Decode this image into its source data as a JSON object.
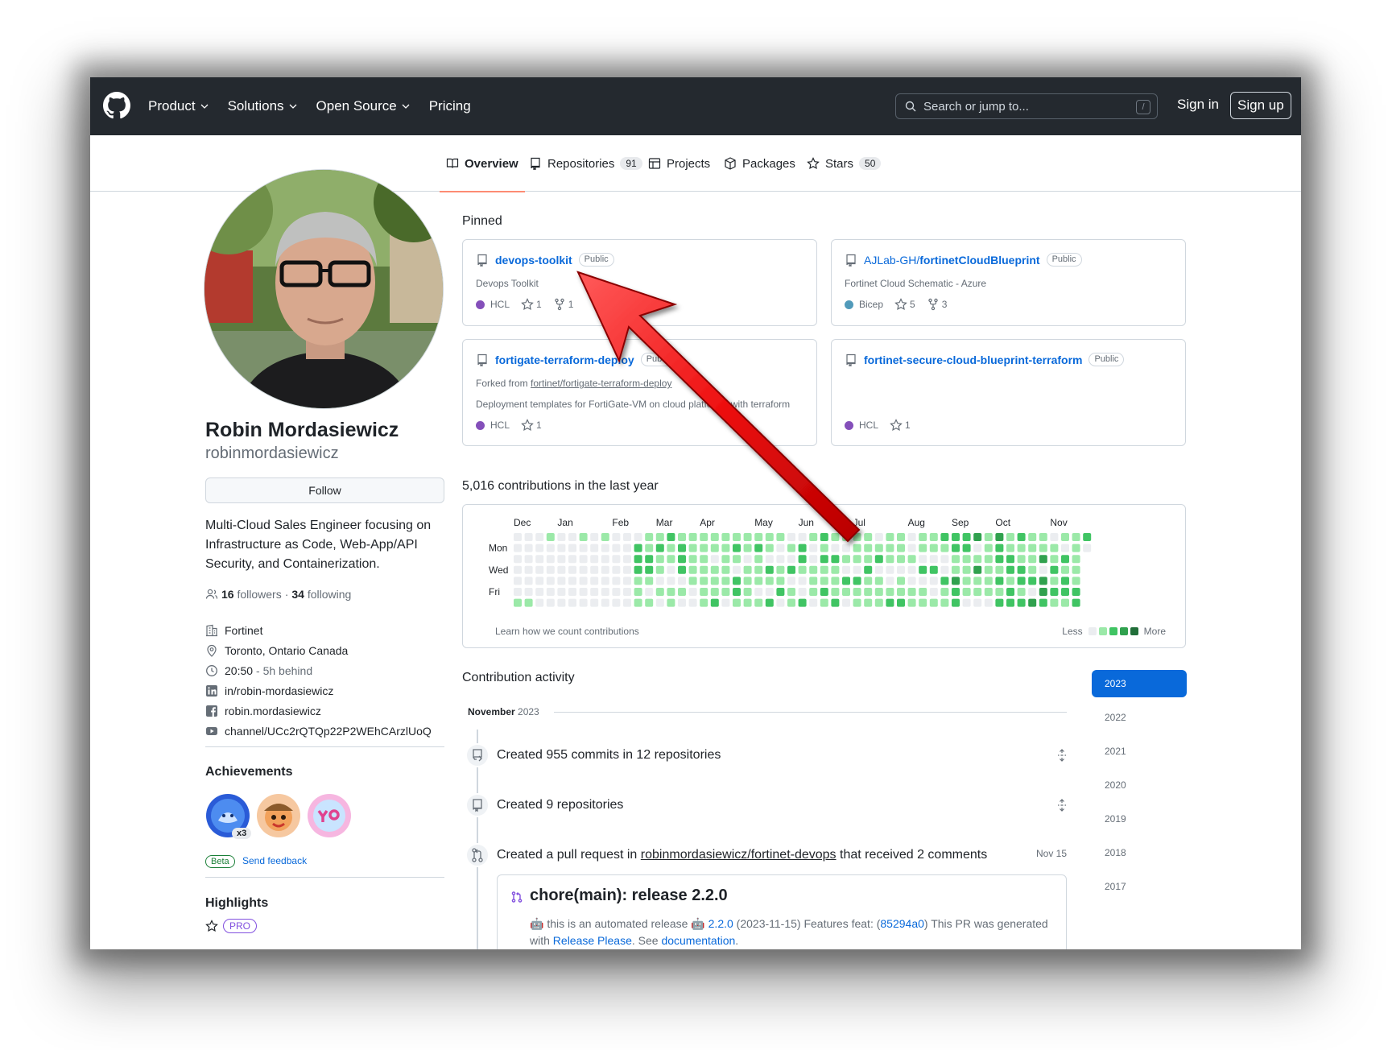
{
  "header": {
    "nav": [
      {
        "label": "Product",
        "dropdown": true
      },
      {
        "label": "Solutions",
        "dropdown": true
      },
      {
        "label": "Open Source",
        "dropdown": true
      },
      {
        "label": "Pricing",
        "dropdown": false
      }
    ],
    "search_placeholder": "Search or jump to...",
    "search_shortcut": "/",
    "sign_in": "Sign in",
    "sign_up": "Sign up"
  },
  "tabs": [
    {
      "label": "Overview",
      "count": "",
      "icon": "book-icon"
    },
    {
      "label": "Repositories",
      "count": "91",
      "icon": "repo-icon"
    },
    {
      "label": "Projects",
      "count": "",
      "icon": "table-icon"
    },
    {
      "label": "Packages",
      "count": "",
      "icon": "package-icon"
    },
    {
      "label": "Stars",
      "count": "50",
      "icon": "star-icon"
    }
  ],
  "profile": {
    "name": "Robin Mordasiewicz",
    "login": "robinmordasiewicz",
    "follow_label": "Follow",
    "bio": "Multi-Cloud Sales Engineer focusing on Infrastructure as Code, Web-App/API Security, and Containerization.",
    "followers": "16",
    "followers_label": "followers",
    "separator": "·",
    "following": "34",
    "following_label": "following",
    "details": [
      {
        "icon": "organization-icon",
        "text": "Fortinet"
      },
      {
        "icon": "location-icon",
        "text": "Toronto, Ontario Canada"
      },
      {
        "icon": "clock-icon",
        "text": "20:50",
        "muted": "- 5h behind"
      },
      {
        "icon": "linkedin-icon",
        "text": "in/robin-mordasiewicz"
      },
      {
        "icon": "facebook-icon",
        "text": "robin.mordasiewicz"
      },
      {
        "icon": "youtube-icon",
        "text": "channel/UCc2rQTQp22P2WEhCArzlUoQ"
      }
    ],
    "achievements_heading": "Achievements",
    "achievement_count": "x3",
    "beta_label": "Beta",
    "feedback_label": "Send feedback",
    "highlights_heading": "Highlights",
    "pro_label": "PRO"
  },
  "pinned": {
    "heading": "Pinned",
    "repos": [
      {
        "owner": "",
        "name": "devops-toolkit",
        "visibility": "Public",
        "forked_prefix": "",
        "forked_from": "",
        "description": "Devops Toolkit",
        "language": "HCL",
        "lang_color": "#844fba",
        "stars": "1",
        "forks": "1"
      },
      {
        "owner": "AJLab-GH/",
        "name": "fortinetCloudBlueprint",
        "visibility": "Public",
        "forked_prefix": "",
        "forked_from": "",
        "description": "Fortinet Cloud Schematic - Azure",
        "language": "Bicep",
        "lang_color": "#519aba",
        "stars": "5",
        "forks": "3"
      },
      {
        "owner": "",
        "name": "fortigate-terraform-deploy",
        "visibility": "Public",
        "forked_prefix": "Forked from",
        "forked_from": "fortinet/fortigate-terraform-deploy",
        "description": "Deployment templates for FortiGate-VM on cloud platforms with terraform",
        "language": "HCL",
        "lang_color": "#844fba",
        "stars": "1",
        "forks": ""
      },
      {
        "owner": "",
        "name": "fortinet-secure-cloud-blueprint-terraform",
        "visibility": "Public",
        "forked_prefix": "",
        "forked_from": "",
        "description": "",
        "language": "HCL",
        "lang_color": "#844fba",
        "stars": "1",
        "forks": ""
      }
    ]
  },
  "contributions": {
    "heading": "5,016 contributions in the last year",
    "months": [
      "Dec",
      "Jan",
      "Feb",
      "Mar",
      "Apr",
      "May",
      "Jun",
      "Jul",
      "Aug",
      "Sep",
      "Oct",
      "Nov"
    ],
    "day_labels": [
      "Mon",
      "Wed",
      "Fri"
    ],
    "learn_label": "Learn how we count contributions",
    "legend_less": "Less",
    "legend_more": "More",
    "level_colors": [
      "#ebedf0",
      "#9be9a8",
      "#40c463",
      "#30a14e",
      "#216e39"
    ]
  },
  "activity": {
    "heading": "Contribution activity",
    "month": "November",
    "year": "2023",
    "years": [
      "2023",
      "2022",
      "2021",
      "2020",
      "2019",
      "2018",
      "2017"
    ],
    "items": [
      {
        "text": "Created 955 commits in 12 repositories",
        "icon": "repo-push-icon"
      },
      {
        "text": "Created 9 repositories",
        "icon": "repo-icon"
      }
    ],
    "pr_prefix": "Created a pull request in",
    "pr_repo": "robinmordasiewicz/fortinet-devops",
    "pr_suffix": "that received 2 comments",
    "pr_date": "Nov 15",
    "pr_title": "chore(main): release 2.2.0",
    "pr_body_1": "🤖 this is an automated release 🤖",
    "pr_version": "2.2.0",
    "pr_body_2": "(2023-11-15) Features feat: (",
    "pr_commit": "85294a0",
    "pr_body_3": ") This PR was generated with",
    "pr_link_1": "Release Please",
    "pr_body_4": ". See",
    "pr_link_2": "documentation",
    "pr_body_5": "."
  }
}
